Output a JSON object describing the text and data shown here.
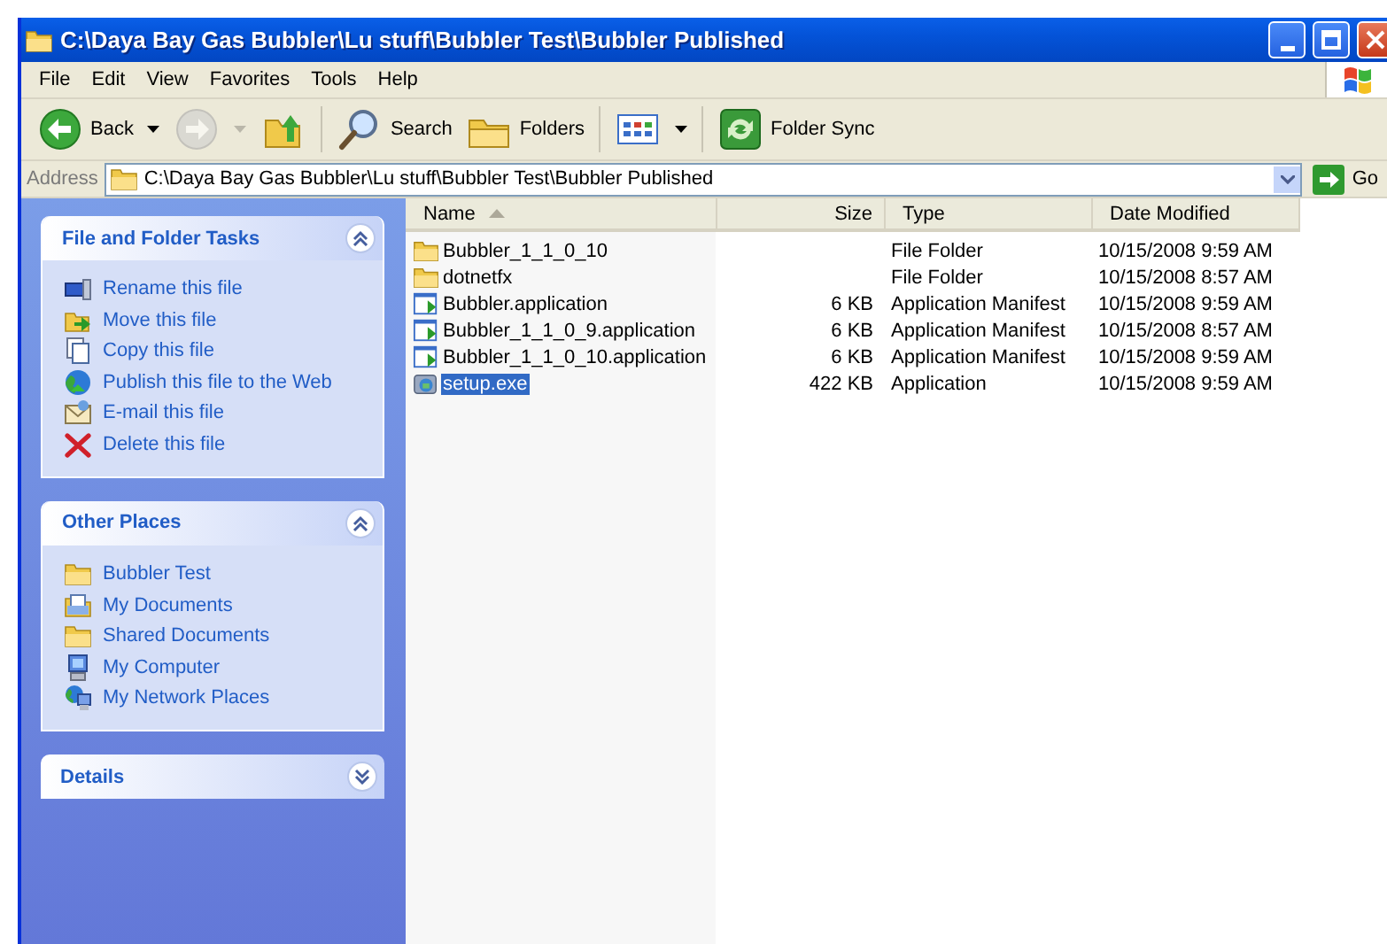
{
  "window": {
    "title": "C:\\Daya Bay Gas Bubbler\\Lu stuff\\Bubbler Test\\Bubbler Published"
  },
  "menu": [
    "File",
    "Edit",
    "View",
    "Favorites",
    "Tools",
    "Help"
  ],
  "toolbar": [
    {
      "kind": "back",
      "label": "Back",
      "disabled": false
    },
    {
      "kind": "forward",
      "disabled": true
    },
    {
      "kind": "up",
      "disabled": false
    },
    {
      "kind": "search",
      "label": "Search",
      "disabled": false
    },
    {
      "kind": "folders",
      "label": "Folders",
      "disabled": false
    },
    {
      "kind": "views",
      "disabled": false
    },
    {
      "kind": "sync",
      "label": "Folder Sync",
      "disabled": false
    }
  ],
  "address": {
    "label": "Address",
    "value": "C:\\Daya Bay Gas Bubbler\\Lu stuff\\Bubbler Test\\Bubbler Published",
    "go": "Go"
  },
  "panels": [
    {
      "title": "File and Folder Tasks",
      "expanded": true,
      "items": [
        {
          "kind": "rename",
          "label": "Rename this file"
        },
        {
          "kind": "move",
          "label": "Move this file"
        },
        {
          "kind": "copy",
          "label": "Copy this file"
        },
        {
          "kind": "publish",
          "label": "Publish this file to the Web"
        },
        {
          "kind": "email",
          "label": "E-mail this file"
        },
        {
          "kind": "delete",
          "label": "Delete this file"
        }
      ]
    },
    {
      "title": "Other Places",
      "expanded": true,
      "items": [
        {
          "kind": "folder",
          "label": "Bubbler Test"
        },
        {
          "kind": "documents",
          "label": "My Documents"
        },
        {
          "kind": "folder",
          "label": "Shared Documents"
        },
        {
          "kind": "computer",
          "label": "My Computer"
        },
        {
          "kind": "network",
          "label": "My Network Places"
        }
      ]
    },
    {
      "title": "Details",
      "expanded": false
    }
  ],
  "table": {
    "columns": [
      {
        "label": "Name",
        "sorted": true
      },
      {
        "label": "Size",
        "sorted": false
      },
      {
        "label": "Type",
        "sorted": false
      },
      {
        "label": "Date Modified",
        "sorted": false
      }
    ],
    "rows": [
      {
        "kind": "folder",
        "name": "Bubbler_1_1_0_10",
        "type": "File Folder",
        "date": "10/15/2008 9:59 AM",
        "selected": false
      },
      {
        "kind": "folder",
        "name": "dotnetfx",
        "type": "File Folder",
        "date": "10/15/2008 8:57 AM",
        "selected": false
      },
      {
        "kind": "manifest",
        "name": "Bubbler.application",
        "size": "6 KB",
        "type": "Application Manifest",
        "date": "10/15/2008 9:59 AM",
        "selected": false
      },
      {
        "kind": "manifest",
        "name": "Bubbler_1_1_0_9.application",
        "size": "6 KB",
        "type": "Application Manifest",
        "date": "10/15/2008 8:57 AM",
        "selected": false
      },
      {
        "kind": "manifest",
        "name": "Bubbler_1_1_0_10.application",
        "size": "6 KB",
        "type": "Application Manifest",
        "date": "10/15/2008 9:59 AM",
        "selected": false
      },
      {
        "kind": "exe",
        "name": "setup.exe",
        "size": "422 KB",
        "type": "Application",
        "date": "10/15/2008 9:59 AM",
        "selected": true
      }
    ]
  }
}
